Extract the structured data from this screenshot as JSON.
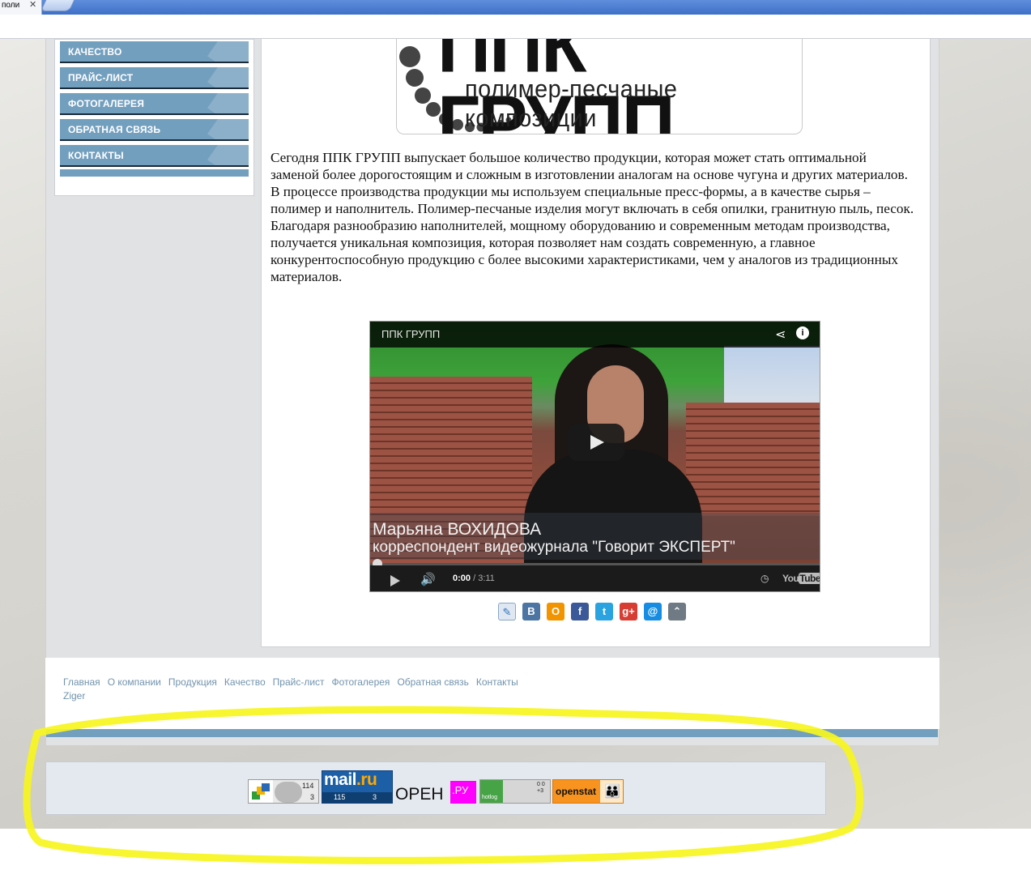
{
  "browser": {
    "tab_title": "поли",
    "tab_close": "✕"
  },
  "sidebar": {
    "items": [
      {
        "label": "КАЧЕСТВО"
      },
      {
        "label": "ПРАЙС-ЛИСТ"
      },
      {
        "label": "ФОТОГАЛЕРЕЯ"
      },
      {
        "label": "ОБРАТНАЯ СВЯЗЬ"
      },
      {
        "label": "КОНТАКТЫ"
      }
    ]
  },
  "logo": {
    "name": "ППК ГРУПП",
    "tagline": "полимер-песчаные композиции"
  },
  "main_text": "Сегодня  ППК ГРУПП выпускает большое количество продукции, которая может стать оптимальной заменой более дорогостоящим и сложным в изготовлении аналогам на основе чугуна и других материалов. В процессе производства продукции мы используем специальные пресс-формы, а в качестве сырья – полимер и наполнитель. Полимер-песчаные изделия могут включать в себя опилки, гранитную пыль, песок. Благодаря разнообразию наполнителей, мощному оборудованию и современным методам производства, получается уникальная композиция, которая позволяет нам создать современную, а главное конкурентоспособную продукцию с более высокими характеристиками, чем у аналогов из традиционных материалов.",
  "video": {
    "title": "ППК ГРУПП",
    "caption_name": "Марьяна ВОХИДОВА",
    "caption_role": "корреспондент видеожурнала \"Говорит ЭКСПЕРТ\"",
    "time_current": "0:00",
    "time_separator": " / ",
    "time_total": "3:11",
    "progress": 0,
    "brand_you": "You",
    "brand_tube": "Tube"
  },
  "share_buttons": [
    {
      "name": "livejournal",
      "glyph": "✎",
      "color": "#dfe8f2"
    },
    {
      "name": "vkontakte",
      "glyph": "В",
      "color": "#4c75a3"
    },
    {
      "name": "odnoklassniki",
      "glyph": "О",
      "color": "#f29400"
    },
    {
      "name": "facebook",
      "glyph": "f",
      "color": "#3b5998"
    },
    {
      "name": "twitter",
      "glyph": "t",
      "color": "#2ba3e1"
    },
    {
      "name": "google-plus",
      "glyph": "g+",
      "color": "#d73d32"
    },
    {
      "name": "mail-ru",
      "glyph": "@",
      "color": "#168de2"
    },
    {
      "name": "more",
      "glyph": "⌃",
      "color": "#6f7a84"
    }
  ],
  "footer": {
    "links": [
      "Главная",
      "О компании",
      "Продукция",
      "Качество",
      "Прайс-лист",
      "Фотогалерея",
      "Обратная связь",
      "Контакты"
    ],
    "credit": "Ziger"
  },
  "counters": {
    "liveinternet": {
      "top": "114",
      "bottom": "3"
    },
    "mailru": {
      "brand_main": "mail",
      "brand_dot": ".ru",
      "visits": "115",
      "hosts": "3"
    },
    "open": {
      "text": "OPEH",
      "badge": ".РУ"
    },
    "hotlog": {
      "label": "hotlog",
      "side": "0 0 +3"
    },
    "openstat": {
      "label": "openstat"
    }
  },
  "colors": {
    "menu": "#739fbf",
    "link": "#7193ad",
    "highlight": "#f6f51e"
  }
}
